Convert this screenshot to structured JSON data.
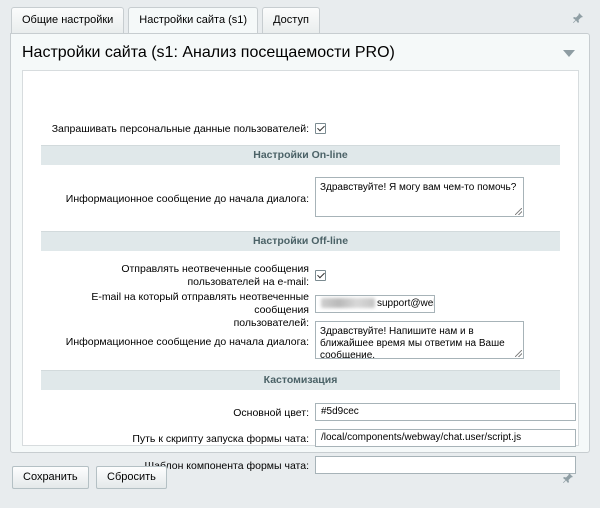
{
  "tabs": [
    {
      "label": "Общие настройки",
      "active": false
    },
    {
      "label": "Настройки сайта (s1)",
      "active": true
    },
    {
      "label": "Доступ",
      "active": false
    }
  ],
  "panel": {
    "title": "Настройки сайта (s1: Анализ посещаемости PRO)"
  },
  "fields": {
    "ask_personal_label": "Запрашивать персональные данные пользователей:",
    "ask_personal_checked": true,
    "online_section": "Настройки On-line",
    "online_msg_label": "Информационное сообщение до начала диалога:",
    "online_msg_value": "Здравствуйте! Я могу вам чем-то помочь?",
    "offline_section": "Настройки Off-line",
    "send_unanswered_label_1": "Отправлять неотвеченные сообщения",
    "send_unanswered_label_2": "пользователей на e-mail:",
    "send_unanswered_checked": true,
    "email_label_1": "E-mail на который отправлять неотвеченные сообщения",
    "email_label_2": "пользователей:",
    "email_value_visible": "support@webw",
    "offline_msg_label": "Информационное сообщение до начала диалога:",
    "offline_msg_value": "Здравствуйте! Напишите нам и в ближайшее время мы ответим на Ваше сообщение.",
    "custom_section": "Кастомизация",
    "color_label": "Основной цвет:",
    "color_value": "#5d9cec",
    "script_label": "Путь к скрипту запуска формы чата:",
    "script_value": "/local/components/webway/chat.user/script.js",
    "template_label": "Шаблон компонента формы чата:",
    "template_value": ""
  },
  "footer": {
    "save_label": "Сохранить",
    "reset_label": "Сбросить"
  },
  "colors": {
    "background": "#e8ecee",
    "panel": "#f5f9f9",
    "section_header": "#e0e8ea",
    "section_text": "#4b6267"
  }
}
